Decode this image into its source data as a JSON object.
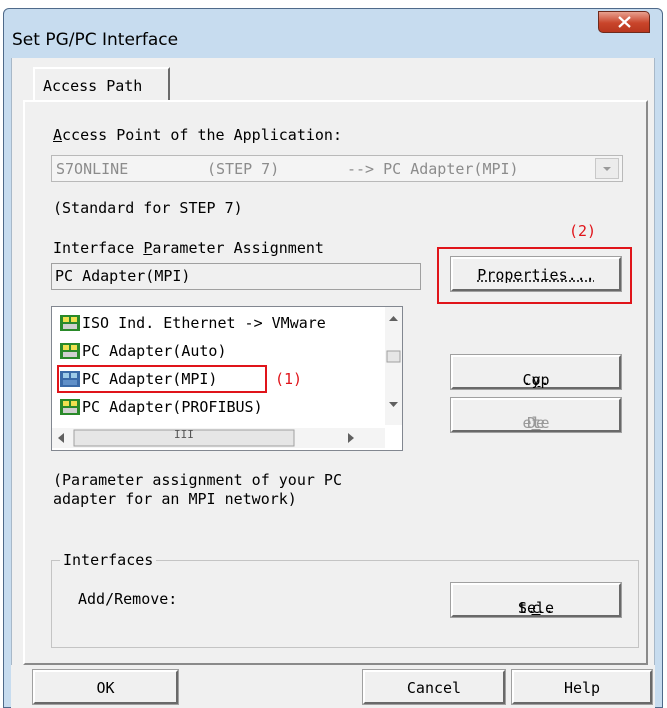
{
  "window": {
    "title": "Set PG/PC Interface"
  },
  "tabs": [
    {
      "label": "Access Path"
    }
  ],
  "access_point": {
    "label_underlined": "A",
    "label_rest": "ccess Point of the Application:",
    "combo": {
      "col1": "S7ONLINE",
      "col2": "(STEP 7)",
      "col3": "--> PC Adapter(MPI)"
    },
    "standard_note": "(Standard for STEP 7)"
  },
  "interface_param": {
    "label_before": "Interface ",
    "label_underlined": "P",
    "label_after": "arameter Assignment",
    "value": "PC Adapter(MPI)"
  },
  "list": {
    "items": [
      {
        "label": "ISO Ind. Ethernet -> VMware",
        "selected": false
      },
      {
        "label": "PC Adapter(Auto)",
        "selected": false
      },
      {
        "label": "PC Adapter(MPI)",
        "selected": true
      },
      {
        "label": "PC Adapter(PROFIBUS)",
        "selected": false
      }
    ],
    "hscroll_grip": "III"
  },
  "buttons": {
    "properties": {
      "before": "",
      "underlined": "",
      "label": "Properties..."
    },
    "copy": {
      "before": "Cop",
      "underlined": "y",
      "after": "..."
    },
    "delete": {
      "before": "De",
      "underlined": "l",
      "after": "ete"
    },
    "select": {
      "before": "Sele",
      "underlined": "c",
      "after": "t..."
    },
    "ok": "OK",
    "cancel": "Cancel",
    "help": "Help"
  },
  "description": {
    "line1": "(Parameter assignment of your PC",
    "line2": "adapter for an MPI network)"
  },
  "interfaces": {
    "title": "Interfaces",
    "add_remove": "Add/Remove:"
  },
  "annotations": {
    "marker1": "(1)",
    "marker2": "(2)"
  },
  "colors": {
    "annotation_red": "#e0141a",
    "title_bar": "#c7dcef",
    "close_button": "#c9452b"
  }
}
